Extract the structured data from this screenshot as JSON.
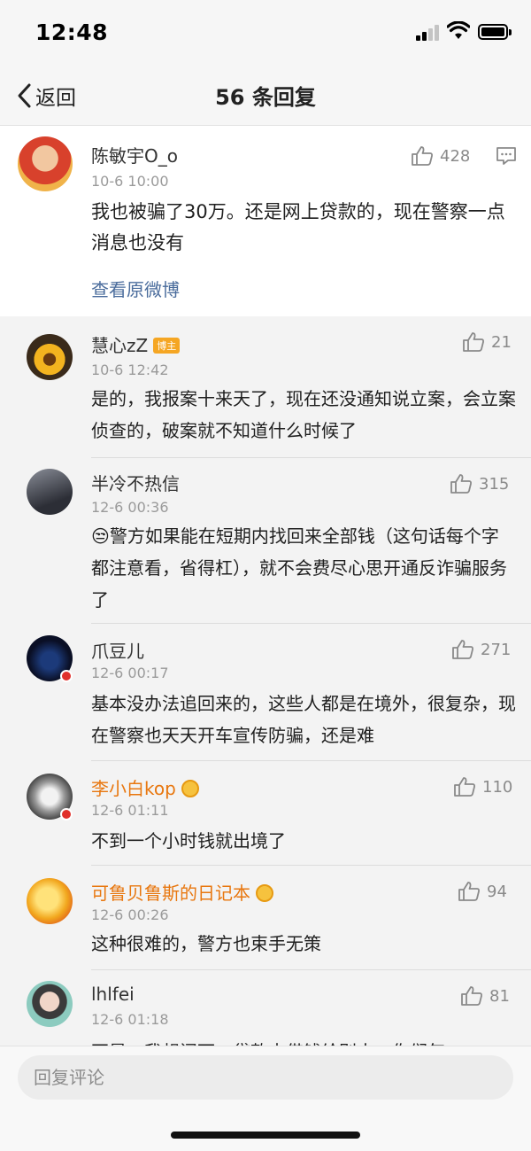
{
  "status": {
    "time": "12:48"
  },
  "nav": {
    "back_label": "返回",
    "title": "56 条回复"
  },
  "main_comment": {
    "username": "陈敏宇O_o",
    "time": "10-6 10:00",
    "text": "我也被骗了30万。还是网上贷款的，现在警察一点消息也没有",
    "likes": "428",
    "view_original": "查看原微博"
  },
  "replies": [
    {
      "username": "慧心zZ",
      "badge": "博主",
      "time": "10-6 12:42",
      "text": "是的，我报案十来天了，现在还没通知说立案，会立案侦查的，破案就不知道什么时候了",
      "likes": "21"
    },
    {
      "username": "半冷不热信",
      "time": "12-6 00:36",
      "text": "😒警方如果能在短期内找回来全部钱（这句话每个字都注意看，省得杠），就不会费尽心思开通反诈骗服务了",
      "likes": "315"
    },
    {
      "username": "爪豆儿",
      "time": "12-6 00:17",
      "text": "基本没办法追回来的，这些人都是在境外，很复杂，现在警察也天天开车宣传防骗，还是难",
      "likes": "271"
    },
    {
      "username": "李小白kop",
      "time": "12-6 01:11",
      "text": "不到一个小时钱就出境了",
      "likes": "110"
    },
    {
      "username": "可鲁贝鲁斯的日记本",
      "time": "12-6 00:26",
      "text": "这种很难的，警方也束手无策",
      "likes": "94"
    },
    {
      "username": "lhlfei",
      "time": "12-6 01:18",
      "text": "不是，我想问下，贷款去借钱给别人，你们怎",
      "likes": "81"
    }
  ],
  "input": {
    "placeholder": "回复评论"
  },
  "colors": {
    "link": "#4a6c9c",
    "vip_name": "#e8770f",
    "badge": "#f5a623"
  }
}
